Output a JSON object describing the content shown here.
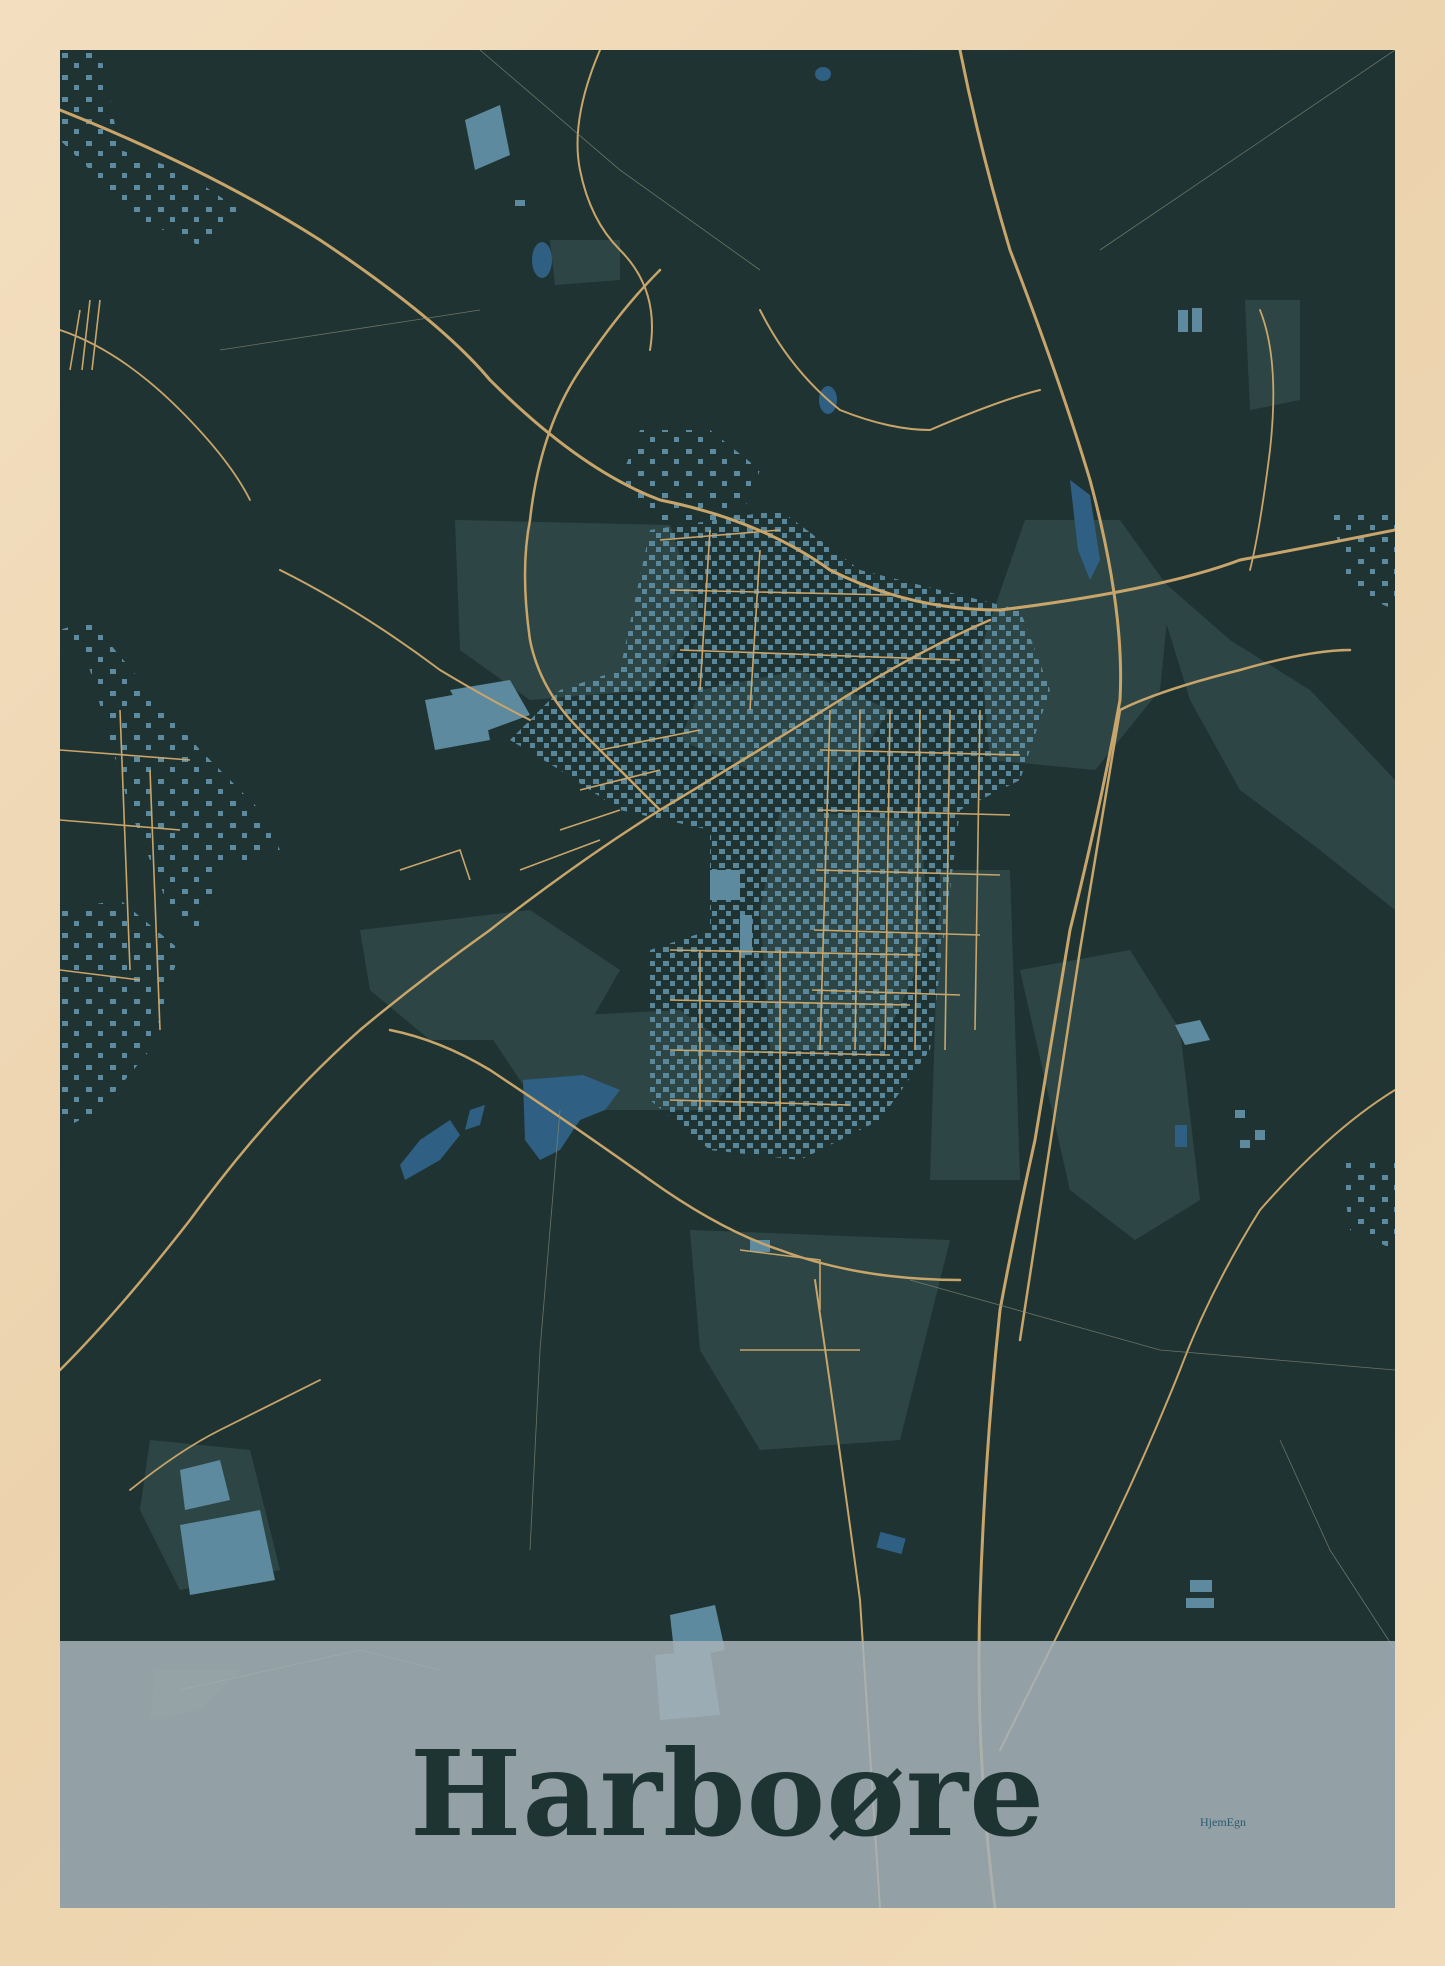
{
  "poster": {
    "title": "Harboøre",
    "brand": "HjemEgn"
  },
  "colors": {
    "frame": "#eed6b3",
    "map_background": "#203333",
    "green_areas": "#2d4645",
    "buildings": "#5d8a9e",
    "roads": "#c8a56a",
    "water": "#2f5f82",
    "title_band": "#a6b2b8",
    "title_text": "#1d3433"
  }
}
